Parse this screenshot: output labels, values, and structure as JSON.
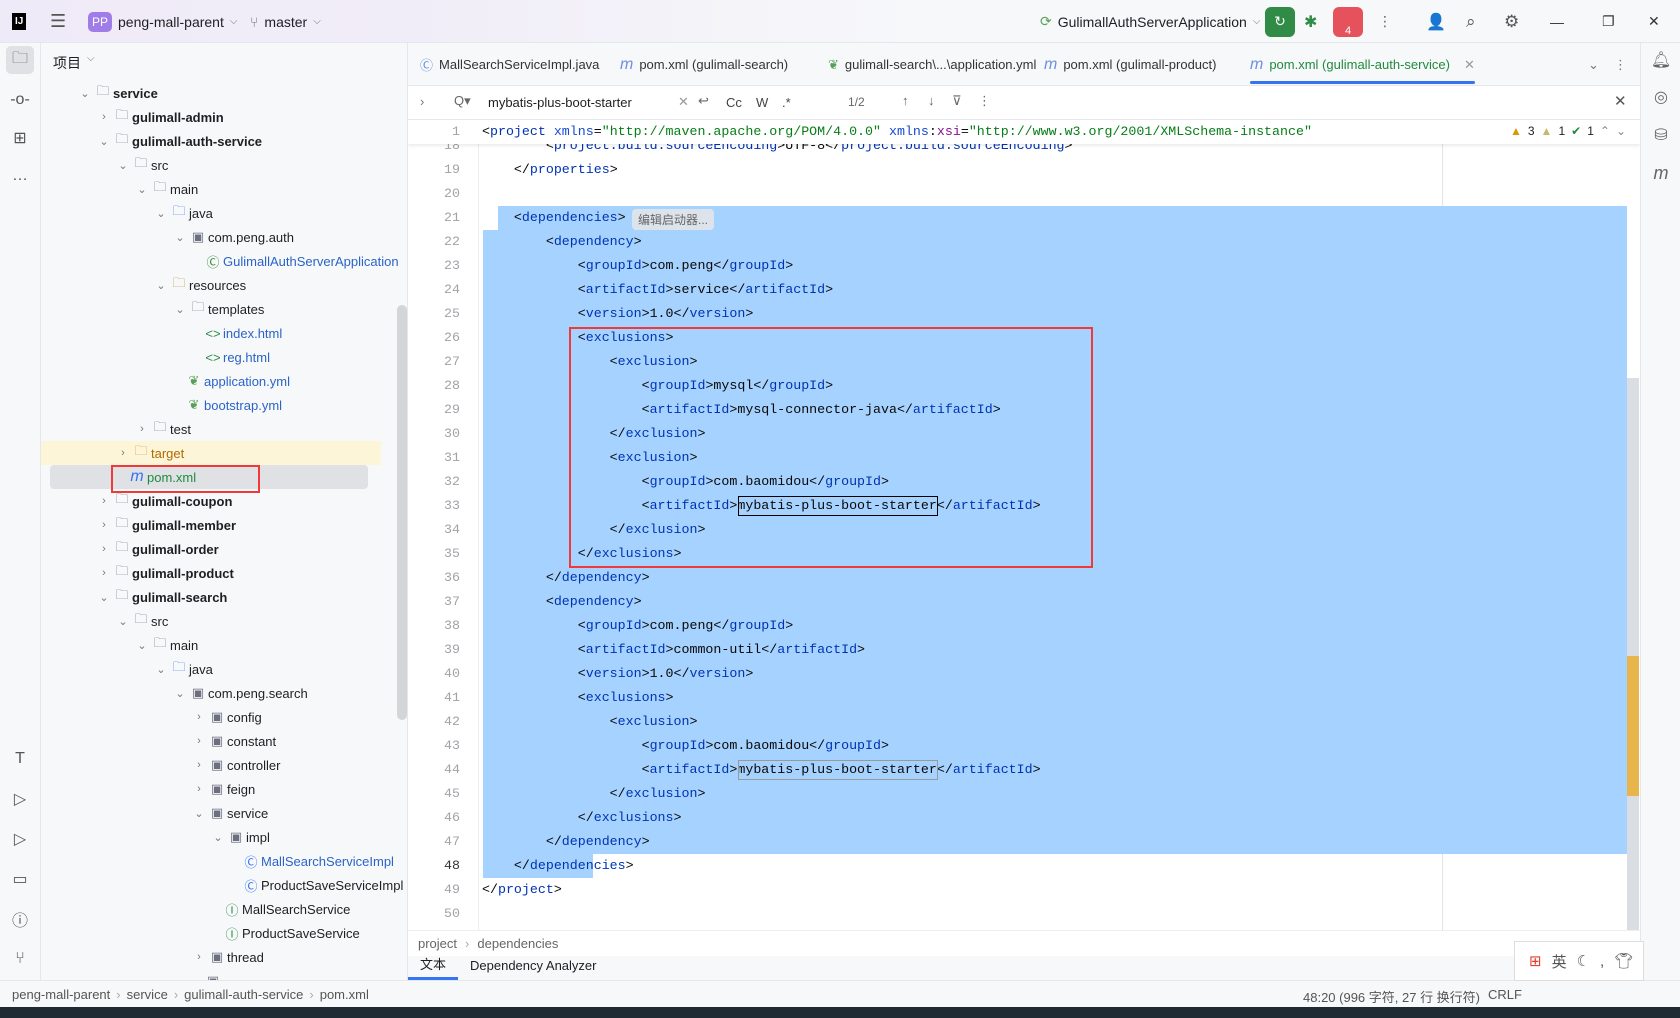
{
  "titlebar": {
    "logo": "IJ",
    "project_badge": "PP",
    "project": "peng-mall-parent",
    "branch": "master",
    "run_config": "GulimallAuthServerApplication",
    "stop_badge": "4",
    "accent": "#a07ce8",
    "run_color": "#2f8b46",
    "stop_color": "#e5525c"
  },
  "project_panel": {
    "title": "项目",
    "items": [
      {
        "d": 0,
        "label": "service",
        "icon": "module-folder",
        "arrow": "open",
        "bold": true
      },
      {
        "d": 1,
        "label": "gulimall-admin",
        "icon": "module-folder",
        "arrow": "closed",
        "bold": true
      },
      {
        "d": 1,
        "label": "gulimall-auth-service",
        "icon": "module-folder",
        "arrow": "open",
        "bold": true
      },
      {
        "d": 2,
        "label": "src",
        "icon": "folder",
        "arrow": "open"
      },
      {
        "d": 3,
        "label": "main",
        "icon": "folder",
        "arrow": "open"
      },
      {
        "d": 4,
        "label": "java",
        "icon": "source-folder",
        "arrow": "open"
      },
      {
        "d": 5,
        "label": "com.peng.auth",
        "icon": "package",
        "arrow": "open"
      },
      {
        "d": 6,
        "label": "GulimallAuthServerApplication",
        "icon": "spring-class",
        "color": "#2a64c8"
      },
      {
        "d": 4,
        "label": "resources",
        "icon": "resource-folder",
        "arrow": "open"
      },
      {
        "d": 5,
        "label": "templates",
        "icon": "folder",
        "arrow": "open"
      },
      {
        "d": 6,
        "label": "index.html",
        "icon": "html",
        "color": "#2a64c8"
      },
      {
        "d": 6,
        "label": "reg.html",
        "icon": "html",
        "color": "#2a64c8"
      },
      {
        "d": 5,
        "label": "application.yml",
        "icon": "yaml",
        "color": "#2a64c8"
      },
      {
        "d": 5,
        "label": "bootstrap.yml",
        "icon": "yaml",
        "color": "#2a64c8"
      },
      {
        "d": 3,
        "label": "test",
        "icon": "folder",
        "arrow": "closed"
      },
      {
        "d": 2,
        "label": "target",
        "icon": "excluded-folder",
        "arrow": "closed",
        "color": "#b06a00",
        "highlight": "yellow"
      },
      {
        "d": 2,
        "label": "pom.xml",
        "icon": "maven",
        "color": "#208a3c",
        "highlight": "selected"
      },
      {
        "d": 1,
        "label": "gulimall-coupon",
        "icon": "module-folder",
        "arrow": "closed",
        "bold": true
      },
      {
        "d": 1,
        "label": "gulimall-member",
        "icon": "module-folder",
        "arrow": "closed",
        "bold": true
      },
      {
        "d": 1,
        "label": "gulimall-order",
        "icon": "module-folder",
        "arrow": "closed",
        "bold": true
      },
      {
        "d": 1,
        "label": "gulimall-product",
        "icon": "module-folder",
        "arrow": "closed",
        "bold": true
      },
      {
        "d": 1,
        "label": "gulimall-search",
        "icon": "module-folder",
        "arrow": "open",
        "bold": true
      },
      {
        "d": 2,
        "label": "src",
        "icon": "folder",
        "arrow": "open"
      },
      {
        "d": 3,
        "label": "main",
        "icon": "folder",
        "arrow": "open"
      },
      {
        "d": 4,
        "label": "java",
        "icon": "source-folder",
        "arrow": "open"
      },
      {
        "d": 5,
        "label": "com.peng.search",
        "icon": "package",
        "arrow": "open"
      },
      {
        "d": 6,
        "label": "config",
        "icon": "package",
        "arrow": "closed"
      },
      {
        "d": 6,
        "label": "constant",
        "icon": "package",
        "arrow": "closed"
      },
      {
        "d": 6,
        "label": "controller",
        "icon": "package",
        "arrow": "closed"
      },
      {
        "d": 6,
        "label": "feign",
        "icon": "package",
        "arrow": "closed"
      },
      {
        "d": 6,
        "label": "service",
        "icon": "package",
        "arrow": "open"
      },
      {
        "d": 7,
        "label": "impl",
        "icon": "package",
        "arrow": "open"
      },
      {
        "d": 8,
        "label": "MallSearchServiceImpl",
        "icon": "class",
        "color": "#2a64c8"
      },
      {
        "d": 8,
        "label": "ProductSaveServiceImpl",
        "icon": "class"
      },
      {
        "d": 7,
        "label": "MallSearchService",
        "icon": "interface"
      },
      {
        "d": 7,
        "label": "ProductSaveService",
        "icon": "interface"
      },
      {
        "d": 6,
        "label": "thread",
        "icon": "package",
        "arrow": "closed"
      },
      {
        "d": 6,
        "label": "",
        "icon": "package"
      }
    ]
  },
  "tabs": [
    {
      "label": "MallSearchServiceImpl.java",
      "icon": "class"
    },
    {
      "label": "pom.xml (gulimall-search)",
      "icon": "maven"
    },
    {
      "label": "gulimall-search\\...\\application.yml",
      "icon": "yaml"
    },
    {
      "label": "pom.xml (gulimall-product)",
      "icon": "maven"
    },
    {
      "label": "pom.xml (gulimall-auth-service)",
      "icon": "maven",
      "active": true
    }
  ],
  "search": {
    "query": "mybatis-plus-boot-starter",
    "match_case": "Cc",
    "words": "W",
    "regex": ".*",
    "count": "1/2"
  },
  "inspections": {
    "warnings": "3",
    "weak_warnings": "1",
    "ok": "1"
  },
  "editor": {
    "sticky": {
      "n": "1",
      "text": "<project xmlns=\"http://maven.apache.org/POM/4.0.0\" xmlns:xsi=\"http://www.w3.org/2001/XMLSchema-instance\""
    },
    "first_line": 18,
    "hint": "编辑启动器...",
    "lines": [
      "        <project.build.sourceEncoding>UTF-8</project.build.sourceEncoding>",
      "    </properties>",
      "",
      "    <dependencies>",
      "        <dependency>",
      "            <groupId>com.peng</groupId>",
      "            <artifactId>service</artifactId>",
      "            <version>1.0</version>",
      "            <exclusions>",
      "                <exclusion>",
      "                    <groupId>mysql</groupId>",
      "                    <artifactId>mysql-connector-java</artifactId>",
      "                </exclusion>",
      "                <exclusion>",
      "                    <groupId>com.baomidou</groupId>",
      "                    <artifactId>mybatis-plus-boot-starter</artifactId>",
      "                </exclusion>",
      "            </exclusions>",
      "        </dependency>",
      "        <dependency>",
      "            <groupId>com.peng</groupId>",
      "            <artifactId>common-util</artifactId>",
      "            <version>1.0</version>",
      "            <exclusions>",
      "                <exclusion>",
      "                    <groupId>com.baomidou</groupId>",
      "                    <artifactId>mybatis-plus-boot-starter</artifactId>",
      "                </exclusion>",
      "            </exclusions>",
      "        </dependency>",
      "    </dependencies>",
      "</project>",
      ""
    ]
  },
  "breadcrumb": [
    "project",
    "dependencies"
  ],
  "bottom_tabs": [
    {
      "label": "文本",
      "active": true
    },
    {
      "label": "Dependency Analyzer"
    }
  ],
  "status": {
    "path": [
      "peng-mall-parent",
      "service",
      "gulimall-auth-service",
      "pom.xml"
    ],
    "position": "48:20 (996 字符, 27 行 换行符)",
    "line_sep": "CRLF",
    "ime": "英"
  }
}
